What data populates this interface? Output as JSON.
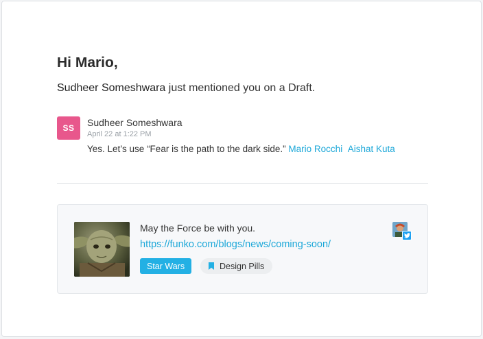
{
  "email": {
    "greeting": "Hi Mario,",
    "intro": {
      "who": "Sudheer Someshwara",
      "rest": " just mentioned you on a Draft."
    }
  },
  "comment": {
    "avatar_initials": "SS",
    "avatar_color": "#e8578c",
    "author": "Sudheer Someshwara",
    "timestamp": "April 22 at 1:22 PM",
    "text": "Yes. Let’s use “Fear is the path to the dark side.” ",
    "mentions": [
      "Mario Rocchi",
      "Aishat Kuta"
    ]
  },
  "post": {
    "image_icon": "yoda-image",
    "text": "May the Force be with you.",
    "link": "https://funko.com/blogs/news/coming-soon/",
    "tags": {
      "primary": "Star Wars",
      "secondary": "Design Pills",
      "secondary_icon": "bookmark-icon"
    },
    "profile_icon": "profile-avatar",
    "source_icon": "twitter-icon"
  },
  "colors": {
    "accent": "#1ba7d8",
    "tag_primary": "#23b0e4",
    "avatar": "#e8578c"
  }
}
